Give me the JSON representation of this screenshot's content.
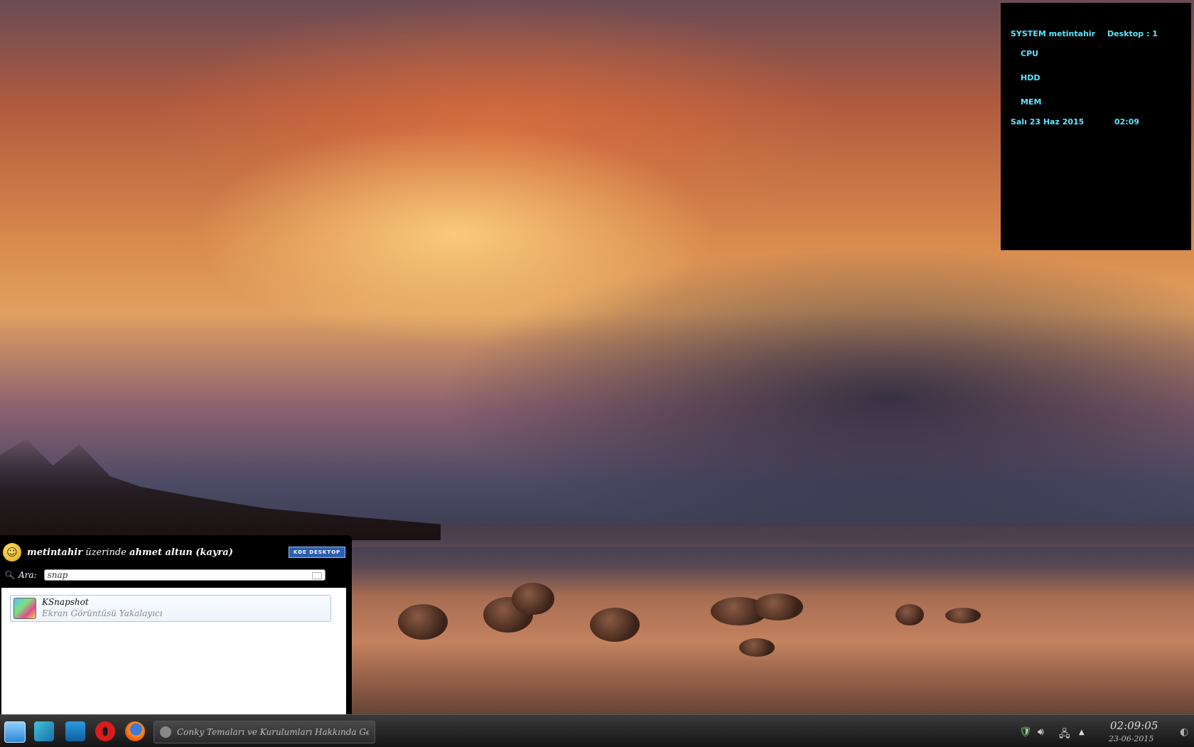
{
  "conky": {
    "system_label": "SYSTEM metintahir",
    "desktop_label": "Desktop : 1",
    "cpu_label": "CPU",
    "hdd_label": "HDD",
    "mem_label": "MEM",
    "date": "Salı 23 Haz 2015",
    "time": "02:09",
    "text_color": "#5ce6ff"
  },
  "launcher": {
    "host": "metintahir",
    "on_word": "üzerinde",
    "user": "ahmet altun (kayra)",
    "kde_badge": "KDE DESKTOP",
    "search_label": "Ara:",
    "search_value": "snap",
    "results": [
      {
        "title": "KSnapshot",
        "subtitle": "Ekran Görüntüsü Yakalayıcı",
        "icon": "ksnapshot-icon"
      }
    ]
  },
  "taskbar": {
    "launchers": [
      "kde-menu-icon",
      "desktop-icon",
      "show-desktop-icon",
      "opera-icon",
      "firefox-icon"
    ],
    "task_label": "Conky Temaları ve Kurulumları Hakkında Ge",
    "clock_time": "02:09:05",
    "clock_date": "23-06-2015"
  }
}
